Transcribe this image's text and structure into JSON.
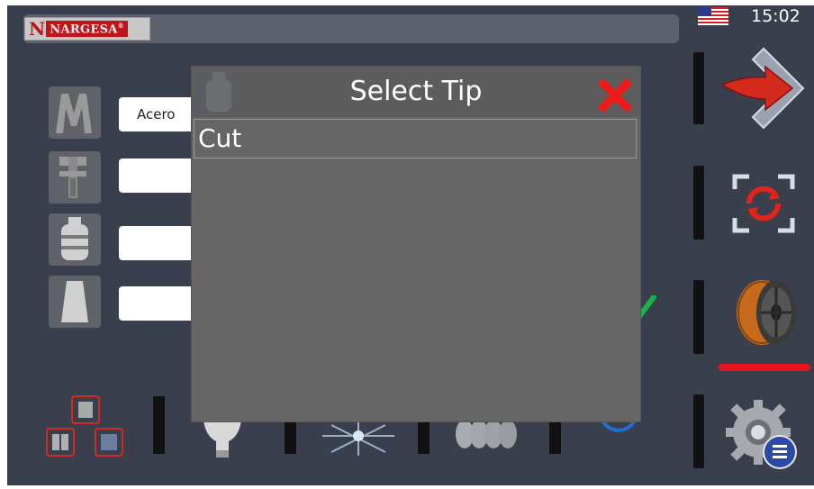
{
  "header": {
    "logo_n": "N",
    "logo_text": "NARGESA",
    "logo_reg": "®",
    "clock": "15:02",
    "language_flag_icon": "us-flag-icon"
  },
  "params": {
    "material_value": "Acero",
    "thickness_value": "",
    "gas_value": "",
    "nozzle_value": ""
  },
  "right_menu": [
    {
      "icon": "next-arrow-icon"
    },
    {
      "icon": "refresh-icon"
    },
    {
      "icon": "wire-spool-icon",
      "active": true
    },
    {
      "icon": "settings-gear-icon"
    }
  ],
  "bottom_bar": [
    {
      "icon": "components-icon"
    },
    {
      "icon": "light-bulb-icon"
    },
    {
      "icon": "spark-icon"
    },
    {
      "icon": "coil-icon"
    },
    {
      "icon": "ring-icon"
    }
  ],
  "modal": {
    "title": "Select Tip",
    "items": [
      "Cut"
    ]
  },
  "colors": {
    "background": "#3a3f4e",
    "modal": "#666666",
    "accent_red": "#e8141c"
  }
}
